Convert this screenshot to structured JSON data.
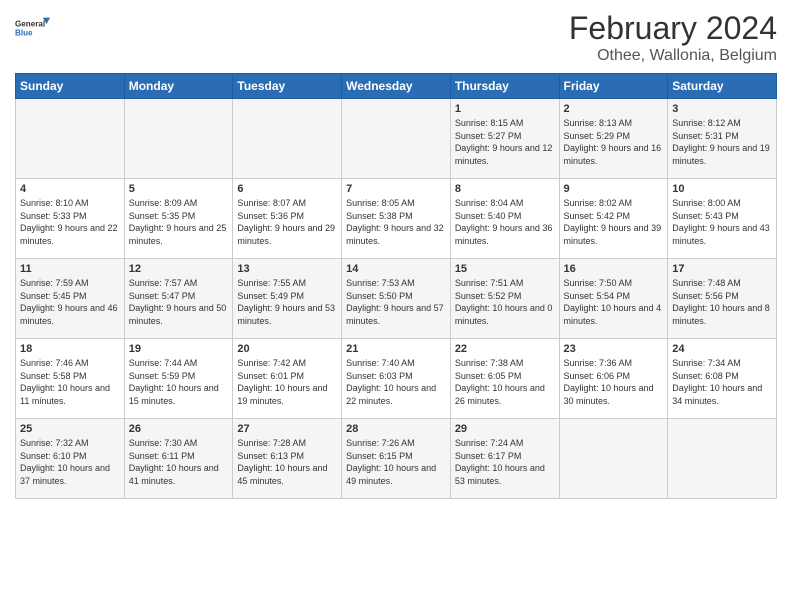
{
  "logo": {
    "general": "General",
    "blue": "Blue"
  },
  "title": "February 2024",
  "subtitle": "Othee, Wallonia, Belgium",
  "headers": [
    "Sunday",
    "Monday",
    "Tuesday",
    "Wednesday",
    "Thursday",
    "Friday",
    "Saturday"
  ],
  "weeks": [
    [
      {
        "day": "",
        "sunrise": "",
        "sunset": "",
        "daylight": ""
      },
      {
        "day": "",
        "sunrise": "",
        "sunset": "",
        "daylight": ""
      },
      {
        "day": "",
        "sunrise": "",
        "sunset": "",
        "daylight": ""
      },
      {
        "day": "",
        "sunrise": "",
        "sunset": "",
        "daylight": ""
      },
      {
        "day": "1",
        "sunrise": "Sunrise: 8:15 AM",
        "sunset": "Sunset: 5:27 PM",
        "daylight": "Daylight: 9 hours and 12 minutes."
      },
      {
        "day": "2",
        "sunrise": "Sunrise: 8:13 AM",
        "sunset": "Sunset: 5:29 PM",
        "daylight": "Daylight: 9 hours and 16 minutes."
      },
      {
        "day": "3",
        "sunrise": "Sunrise: 8:12 AM",
        "sunset": "Sunset: 5:31 PM",
        "daylight": "Daylight: 9 hours and 19 minutes."
      }
    ],
    [
      {
        "day": "4",
        "sunrise": "Sunrise: 8:10 AM",
        "sunset": "Sunset: 5:33 PM",
        "daylight": "Daylight: 9 hours and 22 minutes."
      },
      {
        "day": "5",
        "sunrise": "Sunrise: 8:09 AM",
        "sunset": "Sunset: 5:35 PM",
        "daylight": "Daylight: 9 hours and 25 minutes."
      },
      {
        "day": "6",
        "sunrise": "Sunrise: 8:07 AM",
        "sunset": "Sunset: 5:36 PM",
        "daylight": "Daylight: 9 hours and 29 minutes."
      },
      {
        "day": "7",
        "sunrise": "Sunrise: 8:05 AM",
        "sunset": "Sunset: 5:38 PM",
        "daylight": "Daylight: 9 hours and 32 minutes."
      },
      {
        "day": "8",
        "sunrise": "Sunrise: 8:04 AM",
        "sunset": "Sunset: 5:40 PM",
        "daylight": "Daylight: 9 hours and 36 minutes."
      },
      {
        "day": "9",
        "sunrise": "Sunrise: 8:02 AM",
        "sunset": "Sunset: 5:42 PM",
        "daylight": "Daylight: 9 hours and 39 minutes."
      },
      {
        "day": "10",
        "sunrise": "Sunrise: 8:00 AM",
        "sunset": "Sunset: 5:43 PM",
        "daylight": "Daylight: 9 hours and 43 minutes."
      }
    ],
    [
      {
        "day": "11",
        "sunrise": "Sunrise: 7:59 AM",
        "sunset": "Sunset: 5:45 PM",
        "daylight": "Daylight: 9 hours and 46 minutes."
      },
      {
        "day": "12",
        "sunrise": "Sunrise: 7:57 AM",
        "sunset": "Sunset: 5:47 PM",
        "daylight": "Daylight: 9 hours and 50 minutes."
      },
      {
        "day": "13",
        "sunrise": "Sunrise: 7:55 AM",
        "sunset": "Sunset: 5:49 PM",
        "daylight": "Daylight: 9 hours and 53 minutes."
      },
      {
        "day": "14",
        "sunrise": "Sunrise: 7:53 AM",
        "sunset": "Sunset: 5:50 PM",
        "daylight": "Daylight: 9 hours and 57 minutes."
      },
      {
        "day": "15",
        "sunrise": "Sunrise: 7:51 AM",
        "sunset": "Sunset: 5:52 PM",
        "daylight": "Daylight: 10 hours and 0 minutes."
      },
      {
        "day": "16",
        "sunrise": "Sunrise: 7:50 AM",
        "sunset": "Sunset: 5:54 PM",
        "daylight": "Daylight: 10 hours and 4 minutes."
      },
      {
        "day": "17",
        "sunrise": "Sunrise: 7:48 AM",
        "sunset": "Sunset: 5:56 PM",
        "daylight": "Daylight: 10 hours and 8 minutes."
      }
    ],
    [
      {
        "day": "18",
        "sunrise": "Sunrise: 7:46 AM",
        "sunset": "Sunset: 5:58 PM",
        "daylight": "Daylight: 10 hours and 11 minutes."
      },
      {
        "day": "19",
        "sunrise": "Sunrise: 7:44 AM",
        "sunset": "Sunset: 5:59 PM",
        "daylight": "Daylight: 10 hours and 15 minutes."
      },
      {
        "day": "20",
        "sunrise": "Sunrise: 7:42 AM",
        "sunset": "Sunset: 6:01 PM",
        "daylight": "Daylight: 10 hours and 19 minutes."
      },
      {
        "day": "21",
        "sunrise": "Sunrise: 7:40 AM",
        "sunset": "Sunset: 6:03 PM",
        "daylight": "Daylight: 10 hours and 22 minutes."
      },
      {
        "day": "22",
        "sunrise": "Sunrise: 7:38 AM",
        "sunset": "Sunset: 6:05 PM",
        "daylight": "Daylight: 10 hours and 26 minutes."
      },
      {
        "day": "23",
        "sunrise": "Sunrise: 7:36 AM",
        "sunset": "Sunset: 6:06 PM",
        "daylight": "Daylight: 10 hours and 30 minutes."
      },
      {
        "day": "24",
        "sunrise": "Sunrise: 7:34 AM",
        "sunset": "Sunset: 6:08 PM",
        "daylight": "Daylight: 10 hours and 34 minutes."
      }
    ],
    [
      {
        "day": "25",
        "sunrise": "Sunrise: 7:32 AM",
        "sunset": "Sunset: 6:10 PM",
        "daylight": "Daylight: 10 hours and 37 minutes."
      },
      {
        "day": "26",
        "sunrise": "Sunrise: 7:30 AM",
        "sunset": "Sunset: 6:11 PM",
        "daylight": "Daylight: 10 hours and 41 minutes."
      },
      {
        "day": "27",
        "sunrise": "Sunrise: 7:28 AM",
        "sunset": "Sunset: 6:13 PM",
        "daylight": "Daylight: 10 hours and 45 minutes."
      },
      {
        "day": "28",
        "sunrise": "Sunrise: 7:26 AM",
        "sunset": "Sunset: 6:15 PM",
        "daylight": "Daylight: 10 hours and 49 minutes."
      },
      {
        "day": "29",
        "sunrise": "Sunrise: 7:24 AM",
        "sunset": "Sunset: 6:17 PM",
        "daylight": "Daylight: 10 hours and 53 minutes."
      },
      {
        "day": "",
        "sunrise": "",
        "sunset": "",
        "daylight": ""
      },
      {
        "day": "",
        "sunrise": "",
        "sunset": "",
        "daylight": ""
      }
    ]
  ]
}
